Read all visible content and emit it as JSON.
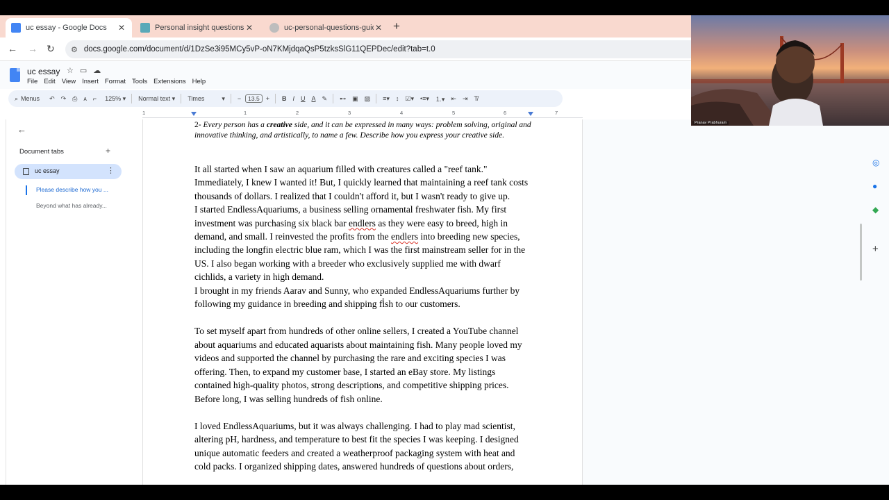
{
  "tabs": [
    {
      "title": "uc essay - Google Docs",
      "active": true
    },
    {
      "title": "Personal insight questions | UC",
      "active": false
    },
    {
      "title": "uc-personal-questions-guide-fr",
      "active": false
    }
  ],
  "address_bar": {
    "url": "docs.google.com/document/d/1DzSe3i95MCy5vP-oN7KMjdqaQsP5tzksSlG11QEPDec/edit?tab=t.0"
  },
  "doc": {
    "title": "uc essay"
  },
  "menu": [
    "File",
    "Edit",
    "View",
    "Insert",
    "Format",
    "Tools",
    "Extensions",
    "Help"
  ],
  "format_toolbar": {
    "menus_label": "Menus",
    "zoom": "125%",
    "style": "Normal text",
    "font": "Times",
    "font_size": "13.5",
    "bold": "B",
    "italic": "I",
    "underline": "U",
    "text_color": "A"
  },
  "ruler_ticks": [
    "1",
    "1",
    "2",
    "3",
    "4",
    "5",
    "6",
    "7"
  ],
  "sidebar": {
    "heading": "Document tabs",
    "tab_label": "uc essay",
    "outline": [
      "Please describe how you ...",
      "Beyond what has already..."
    ]
  },
  "essay": {
    "prompt_number": "2-",
    "prompt_pre": "Every person has a",
    "prompt_bold": "creative",
    "prompt_post": "side, and it can be expressed in many ways: problem solving, original and innovative thinking, and artistically, to name a few. Describe how you express your creative side.",
    "p1": "It all started when I saw an aquarium filled with creatures called a \"reef tank.\" Immediately, I knew I wanted it! But, I quickly learned that maintaining a reef tank costs thousands of dollars. I realized that I couldn't afford it, but I wasn't ready to give up.",
    "p2_a": "I started EndlessAquariums, a business selling ornamental freshwater fish. My first investment was purchasing six black bar",
    "p2_word1": "endlers",
    "p2_b": "as they were easy to breed, high in demand, and small. I reinvested the profits from the",
    "p2_word2": "endlers",
    "p2_c": "into breeding new species, including the longfin electric blue ram, which I was the first mainstream seller for in the US. I also began working with a breeder who exclusively supplied me with dwarf cichlids, a variety in high demand.",
    "p3": "I brought in my friends Aarav and Sunny, who expanded EndlessAquariums further by following my guidance in breeding and shipping fish to our customers.",
    "p4": "To set myself apart from hundreds of other online sellers, I created a YouTube channel about aquariums and educated aquarists about maintaining fish. Many people loved my videos and supported the channel by purchasing the rare and exciting species I was offering. Then, to expand my customer base, I started an eBay store. My listings contained high-quality photos, strong descriptions, and competitive shipping prices. Before long, I was selling hundreds of fish online.",
    "p5": "I loved EndlessAquariums, but it was always challenging. I had to play mad scientist, altering pH, hardness, and temperature to best fit the species I was keeping. I designed unique automatic feeders and created a weatherproof packaging system with heat and cold packs. I organized shipping dates, answered hundreds of questions about orders,"
  },
  "webcam": {
    "name": "Pranav Prabhuram"
  },
  "icons": [
    "back-arrow-icon",
    "forward-arrow-icon",
    "reload-icon",
    "star-icon",
    "folder-icon",
    "cloud-icon",
    "search-icon",
    "undo-icon",
    "redo-icon",
    "print-icon",
    "spellcheck-icon",
    "paint-format-icon",
    "highlighter-icon",
    "link-icon",
    "comment-icon",
    "image-icon",
    "align-icon",
    "line-spacing-icon",
    "checklist-icon",
    "bullet-list-icon",
    "numbered-list-icon",
    "indent-icon",
    "clear-format-icon",
    "kebab-icon",
    "plus-icon"
  ],
  "colors": {
    "tabstrip": "#f9d9cf",
    "docs_blue": "#4285f4",
    "selected_tab": "#d3e3fd",
    "link_blue": "#1967d2",
    "spell_red": "#d93025"
  }
}
